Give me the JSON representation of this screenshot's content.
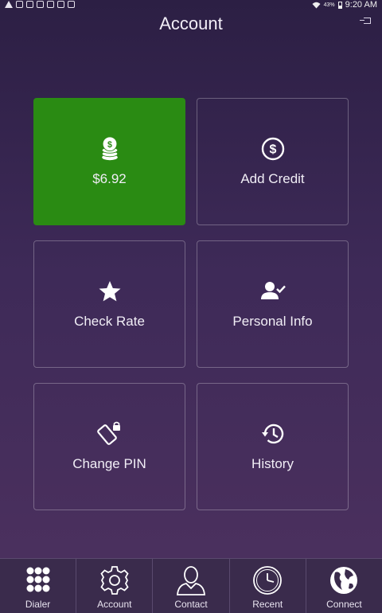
{
  "status_bar": {
    "battery_pct": "43%",
    "time": "9:20 AM"
  },
  "header": {
    "title": "Account"
  },
  "tiles": [
    {
      "label": "$6.92",
      "icon": "coins-icon"
    },
    {
      "label": "Add Credit",
      "icon": "dollar-circle-icon"
    },
    {
      "label": "Check Rate",
      "icon": "star-icon"
    },
    {
      "label": "Personal Info",
      "icon": "user-check-icon"
    },
    {
      "label": "Change PIN",
      "icon": "phone-lock-icon"
    },
    {
      "label": "History",
      "icon": "history-icon"
    }
  ],
  "tabbar": {
    "items": [
      {
        "label": "Dialer",
        "icon": "keypad-icon"
      },
      {
        "label": "Account",
        "icon": "gear-icon"
      },
      {
        "label": "Contact",
        "icon": "person-icon"
      },
      {
        "label": "Recent",
        "icon": "clock-icon"
      },
      {
        "label": "Connect",
        "icon": "globe-icon"
      }
    ]
  },
  "colors": {
    "balance_tile": "#2a8b13",
    "background": "#3e2a58",
    "tabbar": "#3a2b4c"
  }
}
